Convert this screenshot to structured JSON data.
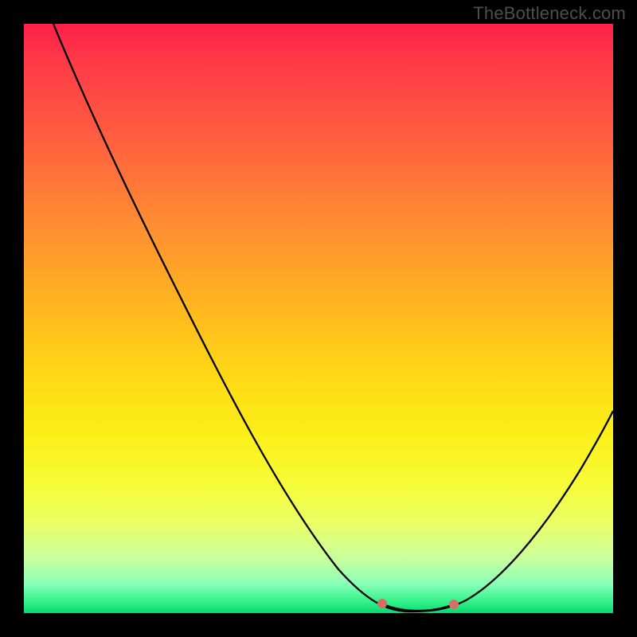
{
  "watermark": "TheBottleneck.com",
  "chart_data": {
    "type": "line",
    "title": "",
    "xlabel": "",
    "ylabel": "",
    "xlim": [
      0,
      100
    ],
    "ylim": [
      0,
      100
    ],
    "x": [
      5,
      10,
      15,
      20,
      25,
      30,
      35,
      40,
      45,
      50,
      55,
      58,
      62,
      66,
      70,
      72,
      76,
      80,
      85,
      90,
      95,
      100
    ],
    "values": [
      100,
      92,
      84,
      76,
      68,
      59,
      51,
      42,
      33,
      24,
      15,
      9,
      4,
      1,
      0,
      0,
      2,
      6,
      13,
      21,
      30,
      39
    ],
    "optimum_range_x": [
      62,
      73
    ],
    "colors": {
      "top": "#ff1f49",
      "mid": "#ffd915",
      "bottom": "#06d96e",
      "curve": "#000000",
      "marker": "#d86f66"
    }
  }
}
